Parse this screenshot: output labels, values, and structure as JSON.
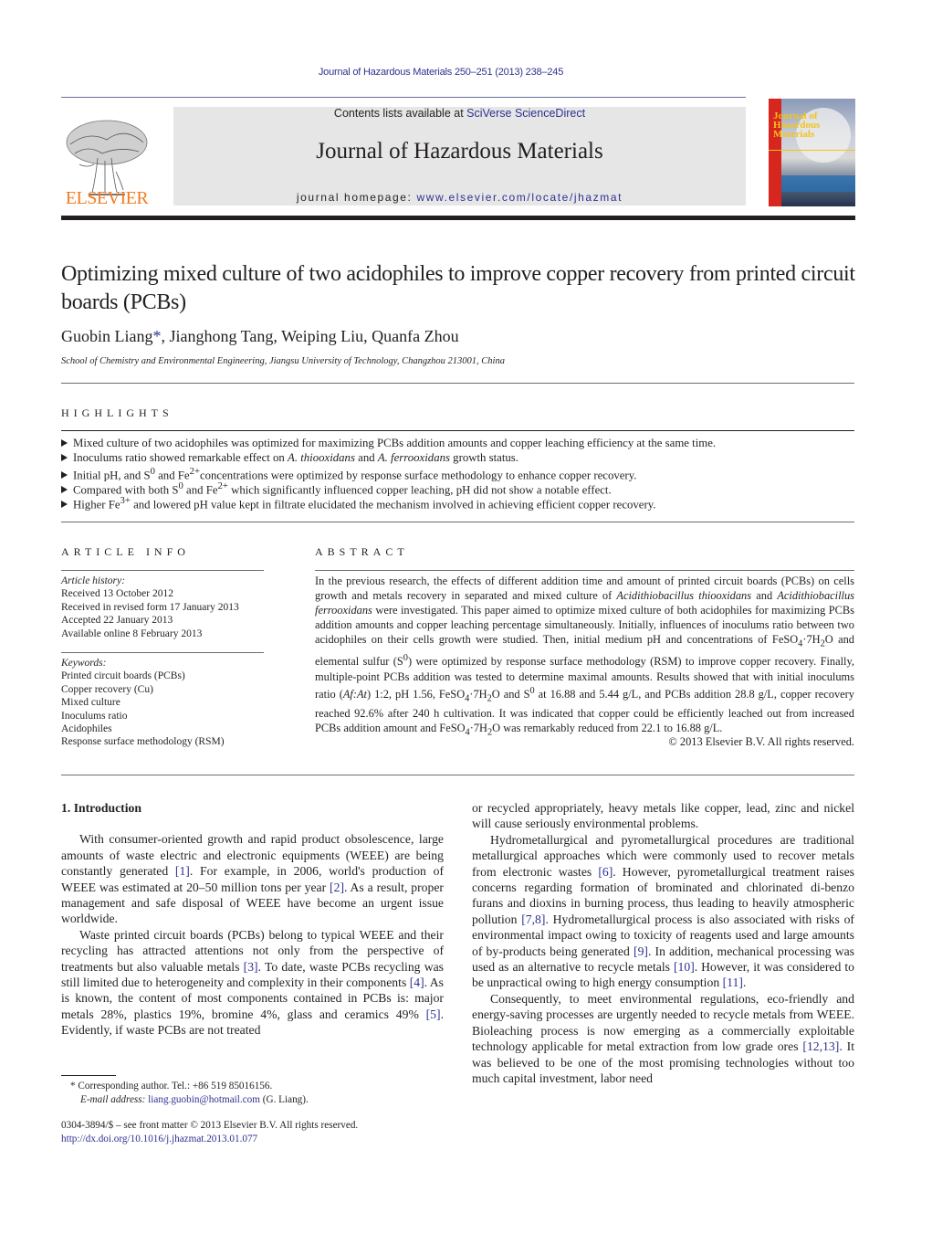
{
  "header": {
    "journal_reference": "Journal of Hazardous Materials 250–251 (2013) 238–245",
    "contents_prefix": "Contents lists available at ",
    "contents_link": "SciVerse ScienceDirect",
    "journal_title": "Journal of Hazardous Materials",
    "homepage_prefix": "journal homepage: ",
    "homepage_link": "www.elsevier.com/locate/jhazmat",
    "publisher_logo_text": "ELSEVIER",
    "cover_title": "Journal of Hazardous Materials",
    "colors": {
      "link": "#2e3192",
      "elsevier_orange": "#f47b20",
      "masthead_bg": "#e6e6e6"
    }
  },
  "article": {
    "title": "Optimizing mixed culture of two acidophiles to improve copper recovery from printed circuit boards (PCBs)",
    "authors": [
      {
        "name": "Guobin Liang",
        "corresponding": "*"
      },
      {
        "name": "Jianghong Tang"
      },
      {
        "name": "Weiping Liu"
      },
      {
        "name": "Quanfa Zhou"
      }
    ],
    "affiliation": "School of Chemistry and Environmental Engineering, Jiangsu University of Technology, Changzhou 213001, China"
  },
  "highlights": {
    "heading": "HIGHLIGHTS",
    "items": [
      [
        "Mixed culture of two acidophiles was optimized for maximizing PCBs addition amounts and copper leaching efficiency at the same time."
      ],
      [
        "Inoculums ratio showed remarkable effect on ",
        "A. thiooxidans",
        " and ",
        "A. ferrooxidans",
        " growth status."
      ],
      [
        "Initial pH, and S",
        "0",
        " and Fe",
        "2+",
        "concentrations were optimized by response surface methodology to enhance copper recovery."
      ],
      [
        "Compared with both S",
        "0",
        " and Fe",
        "2+",
        " which significantly influenced copper leaching, pH did not show a notable effect."
      ],
      [
        "Higher Fe",
        "3+",
        " and lowered pH value kept in filtrate elucidated the mechanism involved in achieving efficient copper recovery."
      ]
    ]
  },
  "article_info": {
    "heading": "ARTICLE INFO",
    "history_label": "Article history:",
    "history": [
      "Received 13 October 2012",
      "Received in revised form 17 January 2013",
      "Accepted 22 January 2013",
      "Available online 8 February 2013"
    ],
    "keywords_label": "Keywords:",
    "keywords": [
      "Printed circuit boards (PCBs)",
      "Copper recovery (Cu)",
      "Mixed culture",
      "Inoculums ratio",
      "Acidophiles",
      "Response surface methodology (RSM)"
    ]
  },
  "abstract": {
    "heading": "ABSTRACT",
    "p1": "In the previous research, the effects of different addition time and amount of printed circuit boards (PCBs) on cells growth and metals recovery in separated and mixed culture of ",
    "sp1": "Acidithiobacillus thiooxidans",
    "p2": " and ",
    "sp2": "Acidithiobacillus ferrooxidans",
    "p3": " were investigated. This paper aimed to optimize mixed culture of both acidophiles for maximizing PCBs addition amounts and copper leaching percentage simultaneously. Initially, influences of inoculums ratio between two acidophiles on their cells growth were studied. Then, initial medium pH and concentrations of FeSO",
    "sub4": "4",
    "p4": "·7H",
    "sub2": "2",
    "p5": "O and elemental sulfur (S",
    "sup0": "0",
    "p6": ") were optimized by response surface methodology (RSM) to improve copper recovery. Finally, multiple-point PCBs addition was tested to determine maximal amounts. Results showed that with initial inoculums ratio (",
    "ratio_label": "Af:At",
    "p7": ") 1:2, pH 1.56, FeSO",
    "p8": "·7H",
    "p9": "O and S",
    "p10": " at 16.88 and 5.44 g/L, and PCBs addition 28.8 g/L, copper recovery reached 92.6% after 240 h cultivation. It was indicated that copper could be efficiently leached out from increased PCBs addition amount and FeSO",
    "p11": "·7H",
    "p12": "O was remarkably reduced from 22.1 to 16.88 g/L.",
    "copyright": "© 2013 Elsevier B.V. All rights reserved."
  },
  "introduction": {
    "heading": "1.  Introduction",
    "left_paragraphs": [
      [
        "With consumer-oriented growth and rapid product obsolescence, large amounts of waste electric and electronic equipments (WEEE) are being constantly generated ",
        "[1]",
        ". For example, in 2006, world's production of WEEE was estimated at 20–50 million tons per year ",
        "[2]",
        ". As a result, proper management and safe disposal of WEEE have become an urgent issue worldwide."
      ],
      [
        "Waste printed circuit boards (PCBs) belong to typical WEEE and their recycling has attracted attentions not only from the perspective of treatments but also valuable metals ",
        "[3]",
        ". To date, waste PCBs recycling was still limited due to heterogeneity and complexity in their components ",
        "[4]",
        ". As is known, the content of most components contained in PCBs is: major metals 28%, plastics 19%, bromine 4%, glass and ceramics 49% ",
        "[5]",
        ". Evidently, if waste PCBs are not treated"
      ]
    ],
    "right_paragraphs": [
      [
        "or recycled appropriately, heavy metals like copper, lead, zinc and nickel will cause seriously environmental problems."
      ],
      [
        "Hydrometallurgical and pyrometallurgical procedures are traditional metallurgical approaches which were commonly used to recover metals from electronic wastes ",
        "[6]",
        ". However, pyrometallurgical treatment raises concerns regarding formation of brominated and chlorinated di-benzo furans and dioxins in burning process, thus leading to heavily atmospheric pollution ",
        "[7,8]",
        ". Hydrometallurgical process is also associated with risks of environmental impact owing to toxicity of reagents used and large amounts of by-products being generated ",
        "[9]",
        ". In addition, mechanical processing was used as an alternative to recycle metals ",
        "[10]",
        ". However, it was considered to be unpractical owing to high energy consumption ",
        "[11]",
        "."
      ],
      [
        "Consequently, to meet environmental regulations, eco-friendly and energy-saving processes are urgently needed to recycle metals from WEEE. Bioleaching process is now emerging as a commercially exploitable technology applicable for metal extraction from low grade ores ",
        "[12,13]",
        ". It was believed to be one of the most promising technologies without too much capital investment, labor need"
      ]
    ]
  },
  "footnotes": {
    "corresponding": "* Corresponding author. Tel.: +86 519 85016156.",
    "email_label": "E-mail address: ",
    "email": "liang.guobin@hotmail.com",
    "email_suffix": " (G. Liang).",
    "issn_line": "0304-3894/$ – see front matter © 2013 Elsevier B.V. All rights reserved.",
    "doi": "http://dx.doi.org/10.1016/j.jhazmat.2013.01.077"
  }
}
